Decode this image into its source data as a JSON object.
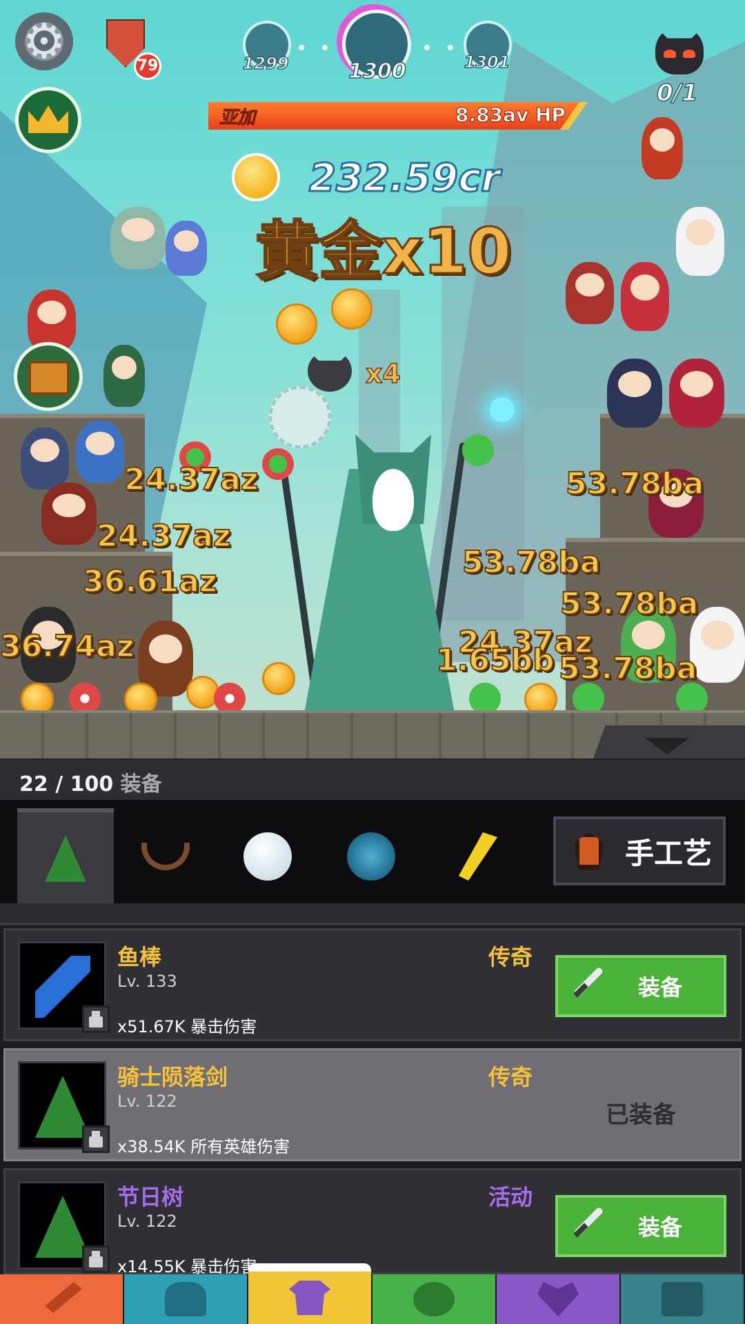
{
  "hud": {
    "chat_badge_count": "79",
    "stages": {
      "prev": "1299",
      "current": "1300",
      "next": "1301"
    },
    "boss_counter": "0/1"
  },
  "boss": {
    "name": "亚加",
    "hp": "8.83av HP"
  },
  "gold": {
    "amount": "232.59cr",
    "multiplier": "黄金x10",
    "devil_multiplier": "x4"
  },
  "damage_numbers": [
    "24.37az",
    "24.37az",
    "36.61az",
    "36.74az",
    "53.78ba",
    "53.78ba",
    "53.78ba",
    "53.78ba",
    "24.37az",
    "1.65bb"
  ],
  "equipment": {
    "count": "22 / 100",
    "count_label": "装备",
    "craft_label": "手工艺",
    "categories": [
      "christmas-tree",
      "antlers",
      "snowball",
      "blue-aura",
      "golden-blade"
    ],
    "items": [
      {
        "name": "鱼棒",
        "level": "Lv. 133",
        "bonus": "x51.67K 暴击伤害",
        "rarity": "传奇",
        "action": "装备",
        "equipped": false
      },
      {
        "name": "骑士陨落剑",
        "level": "Lv. 122",
        "bonus": "x38.54K 所有英雄伤害",
        "rarity": "传奇",
        "action": "已装备",
        "equipped": true
      },
      {
        "name": "节日树",
        "level": "Lv. 122",
        "bonus": "x14.55K 暴击伤害",
        "rarity": "活动",
        "action": "装备",
        "equipped": false
      }
    ]
  },
  "colors": {
    "legendary": "#f6c23a",
    "event": "#a56ee8",
    "equip_button": "#4cb33a",
    "nav": [
      "#ec6a3c",
      "#2f9fb6",
      "#f0c637",
      "#48b24a",
      "#8a57c8",
      "#36828b"
    ]
  },
  "nav": [
    "sword-tab",
    "heroes-tab",
    "equipment-tab",
    "pets-tab",
    "clan-tab",
    "shop-tab"
  ]
}
